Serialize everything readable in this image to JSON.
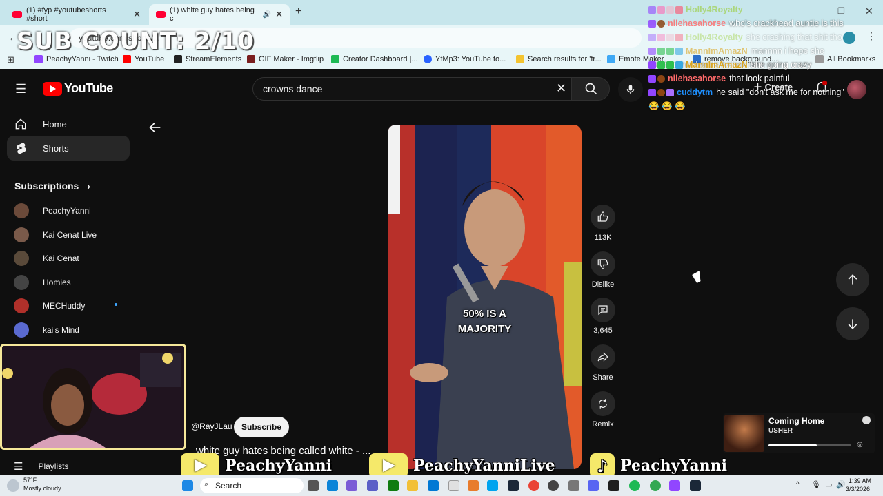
{
  "browser": {
    "tabs": [
      {
        "title": "(1) #fyp #youtubeshorts #short"
      },
      {
        "title": "(1) white guy hates being c"
      }
    ],
    "url": "youtube.com/shorts/...",
    "bookmarks": [
      {
        "label": "PeachyYanni - Twitch",
        "color": "#9146ff"
      },
      {
        "label": "YouTube",
        "color": "#ff0000"
      },
      {
        "label": "StreamElements",
        "color": "#222222"
      },
      {
        "label": "GIF Maker - Imgflip",
        "color": "#7a1f1f"
      },
      {
        "label": "Creator Dashboard |...",
        "color": "#1db954"
      },
      {
        "label": "YtMp3: YouTube to...",
        "color": "#2962ff"
      },
      {
        "label": "Search results for 'fr...",
        "color": "#f4c430"
      },
      {
        "label": "Emote Maker",
        "color": "#3fa9f5"
      },
      {
        "label": "remove background...",
        "color": "#2a6ec9"
      }
    ],
    "all_bookmarks": "All Bookmarks"
  },
  "overlay": {
    "sub_count": "SUB COUNT: 2/10"
  },
  "youtube": {
    "logo_text": "YouTube",
    "search_query": "crowns dance",
    "create_label": "Create",
    "nav": [
      {
        "label": "Home",
        "icon": "home-icon"
      },
      {
        "label": "Shorts",
        "icon": "shorts-icon"
      }
    ],
    "subscriptions_title": "Subscriptions",
    "subscriptions": [
      {
        "name": "PeachyYanni",
        "color": "#6b4a3a"
      },
      {
        "name": "Kai Cenat Live",
        "color": "#7a5a4a"
      },
      {
        "name": "Kai Cenat",
        "color": "#5a4a3a"
      },
      {
        "name": "Homies",
        "color": "#444444"
      },
      {
        "name": "MECHuddy",
        "color": "#b0302a"
      },
      {
        "name": "kai's Mind",
        "color": "#5a6ad0"
      }
    ],
    "playlists_label": "Playlists"
  },
  "short": {
    "caption": "50% IS A\nMAJORITY",
    "channel_handle": "@RayJLau",
    "subscribe_label": "Subscribe",
    "title": "white guy hates being called white - ...",
    "actions": [
      {
        "label": "113K",
        "icon": "like-icon"
      },
      {
        "label": "Dislike",
        "icon": "dislike-icon"
      },
      {
        "label": "3,645",
        "icon": "comment-icon"
      },
      {
        "label": "Share",
        "icon": "share-icon"
      },
      {
        "label": "Remix",
        "icon": "remix-icon"
      }
    ]
  },
  "chat": [
    {
      "user": "Holly4Royalty",
      "color": "#9acd32",
      "msg": ""
    },
    {
      "user": "nilehasahorse",
      "color": "#ff6a6a",
      "msg": "who's crackhead auntie is this"
    },
    {
      "user": "Holly4Royalty",
      "color": "#9acd32",
      "msg": "she crashing that shit tho"
    },
    {
      "user": "MannImAmazN",
      "color": "#daa520",
      "msg": "mannnn i hope she washed her hands before that"
    },
    {
      "user": "MannImAmazN",
      "color": "#daa520",
      "msg": "she going crazy"
    },
    {
      "user": "nilehasahorse",
      "color": "#ff6a6a",
      "msg": "that look painful"
    },
    {
      "user": "cuddytm",
      "color": "#1e90ff",
      "msg": "he said \"don't ask me for nothing\" 😂 😂 😂"
    }
  ],
  "now_playing": {
    "title": "Coming Home",
    "artist": "USHER",
    "progress": 0.58
  },
  "socials": [
    {
      "name": "PeachyYanni",
      "platform": "youtube"
    },
    {
      "name": "PeachyYanniLive",
      "platform": "youtube"
    },
    {
      "name": "PeachyYanni",
      "platform": "tiktok"
    }
  ],
  "taskbar": {
    "weather_temp": "57°F",
    "weather_desc": "Mostly cloudy",
    "search_label": "Search",
    "time": "1:39 AM",
    "date": "3/3/2026"
  }
}
